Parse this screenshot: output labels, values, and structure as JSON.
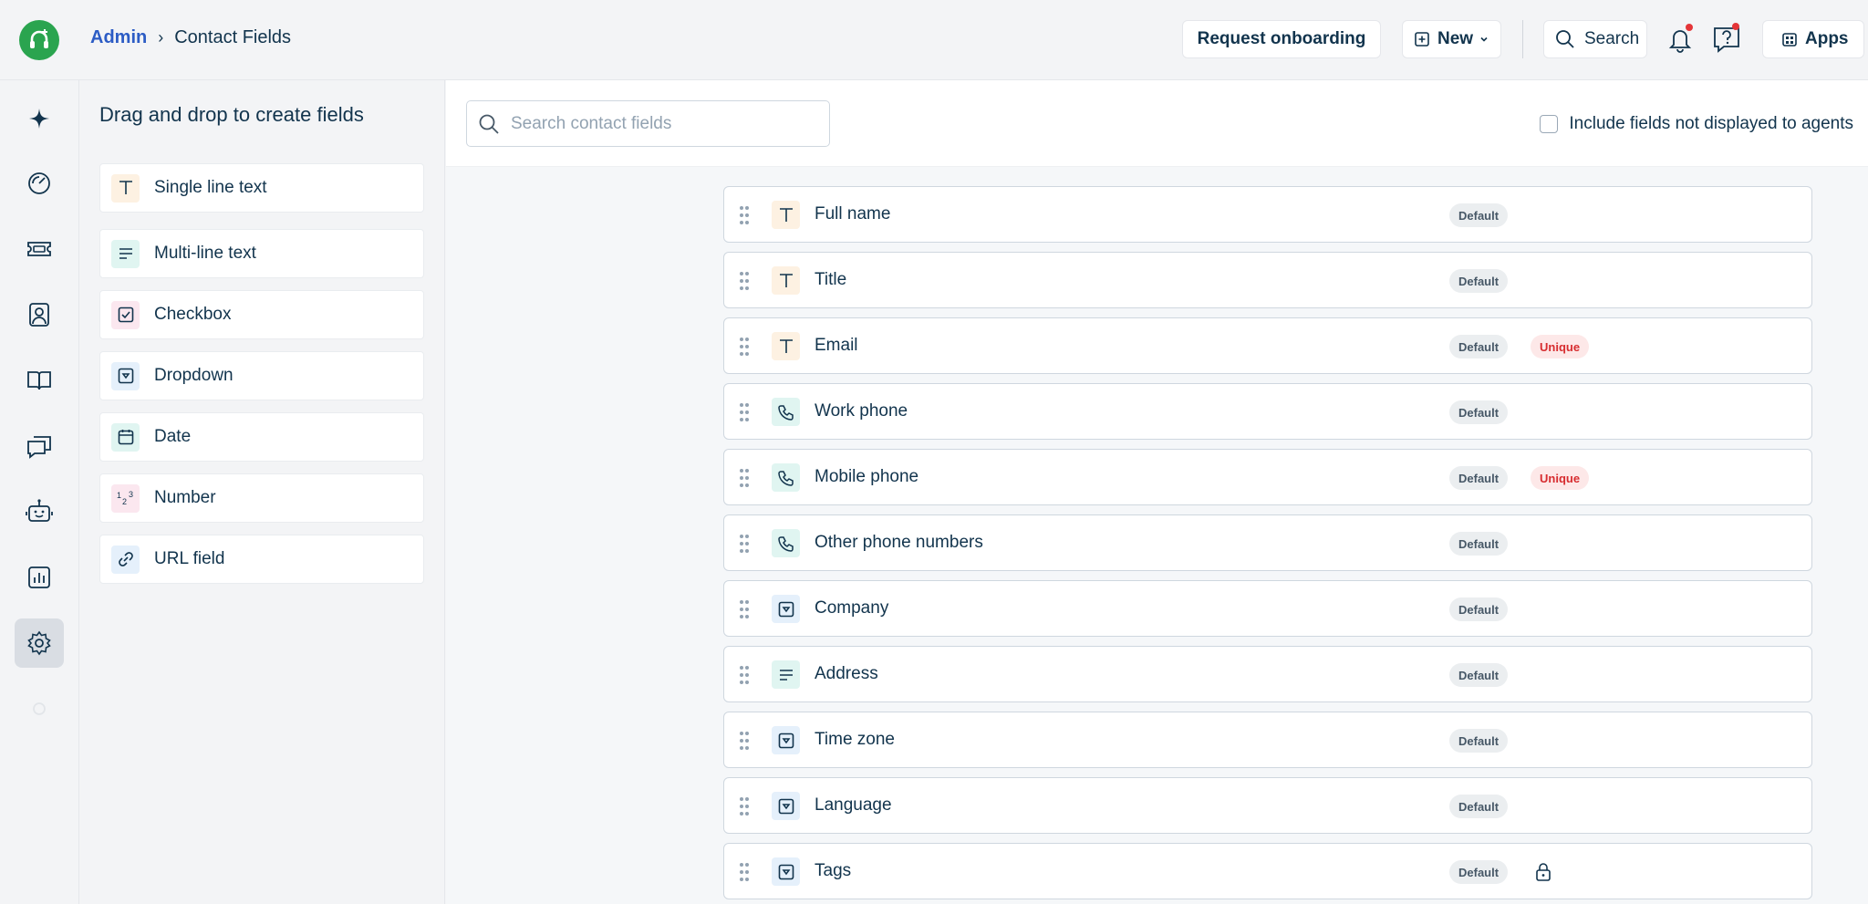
{
  "breadcrumb": {
    "parent": "Admin",
    "current": "Contact Fields"
  },
  "topbar": {
    "request_onboarding": "Request onboarding",
    "new_label": "New",
    "search_label": "Search",
    "apps_label": "Apps"
  },
  "palette": {
    "title": "Drag and drop to create fields",
    "items": [
      {
        "label": "Single line text",
        "icon": "text-type-icon"
      },
      {
        "label": "Multi-line text",
        "icon": "paragraph-lines-icon"
      },
      {
        "label": "Checkbox",
        "icon": "checkbox-icon"
      },
      {
        "label": "Dropdown",
        "icon": "dropdown-icon"
      },
      {
        "label": "Date",
        "icon": "calendar-icon"
      },
      {
        "label": "Number",
        "icon": "number-icon"
      },
      {
        "label": "URL field",
        "icon": "link-icon"
      }
    ]
  },
  "main": {
    "search_placeholder": "Search contact fields",
    "include_label": "Include fields not displayed to agents",
    "fields": [
      {
        "name": "Full name",
        "type": "text",
        "badges": [
          "Default"
        ]
      },
      {
        "name": "Title",
        "type": "text",
        "badges": [
          "Default"
        ]
      },
      {
        "name": "Email",
        "type": "text",
        "badges": [
          "Default",
          "Unique"
        ]
      },
      {
        "name": "Work phone",
        "type": "phone",
        "badges": [
          "Default"
        ]
      },
      {
        "name": "Mobile phone",
        "type": "phone",
        "badges": [
          "Default",
          "Unique"
        ]
      },
      {
        "name": "Other phone numbers",
        "type": "phone",
        "badges": [
          "Default"
        ]
      },
      {
        "name": "Company",
        "type": "dropdown",
        "badges": [
          "Default"
        ]
      },
      {
        "name": "Address",
        "type": "lines",
        "badges": [
          "Default"
        ]
      },
      {
        "name": "Time zone",
        "type": "dropdown",
        "badges": [
          "Default"
        ]
      },
      {
        "name": "Language",
        "type": "dropdown",
        "badges": [
          "Default"
        ]
      },
      {
        "name": "Tags",
        "type": "dropdown",
        "badges": [
          "Default"
        ],
        "locked": true
      }
    ]
  },
  "colors": {
    "brand": "#2aa44f",
    "link": "#2c5cc5",
    "text": "#12344d",
    "unique": "#d72d30"
  }
}
